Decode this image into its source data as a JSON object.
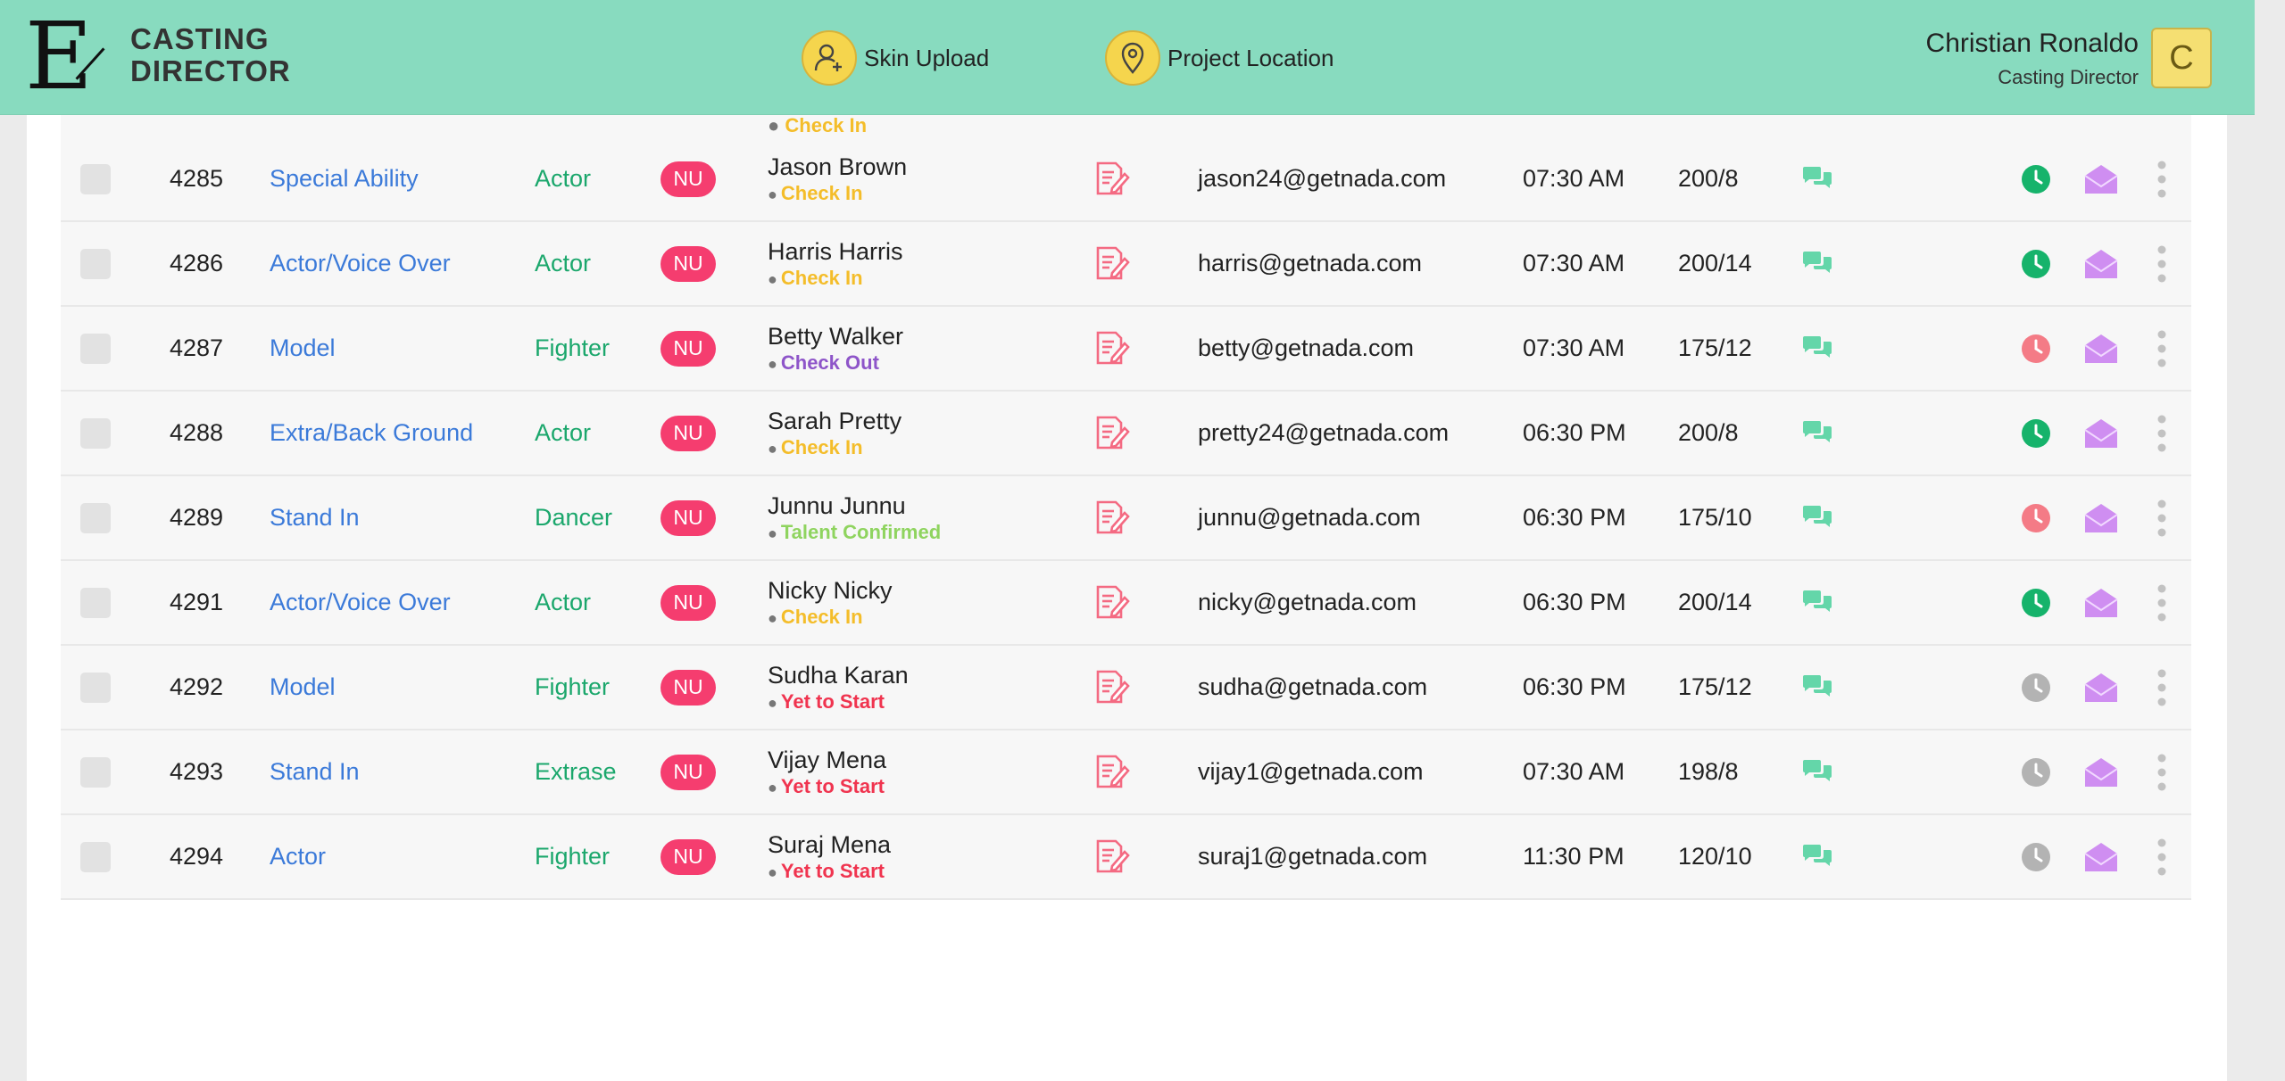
{
  "header": {
    "logo_letter": "E",
    "logo_line1": "CASTING",
    "logo_line2": "DIRECTOR",
    "nav": [
      {
        "label": "Skin Upload",
        "icon": "user-plus-icon"
      },
      {
        "label": "Project Location",
        "icon": "location-pin-icon"
      }
    ],
    "user_name": "Christian Ronaldo",
    "user_role": "Casting Director",
    "avatar_letter": "C"
  },
  "partial_row_status": "Check In",
  "colors": {
    "header_bg": "#88dbbf",
    "badge": "#f53d6f",
    "check_in": "#f4bd2a",
    "check_out": "#8e55c9",
    "talent_confirmed": "#8fd45f",
    "yet_to_start": "#f0344f",
    "clock_green": "#16b36b",
    "clock_red": "#f47b86",
    "clock_gray": "#b3b3b3",
    "chat": "#64d6a9",
    "mail": "#cf8ef1"
  },
  "rows": [
    {
      "id": "4285",
      "role": "Special Ability",
      "type": "Actor",
      "badge": "NU",
      "name": "Jason Brown",
      "status": "Check In",
      "status_kind": "check_in",
      "email": "jason24@getnada.com",
      "time": "07:30 AM",
      "size": "200/8",
      "clock": "green"
    },
    {
      "id": "4286",
      "role": "Actor/Voice Over",
      "type": "Actor",
      "badge": "NU",
      "name": "Harris Harris",
      "status": "Check In",
      "status_kind": "check_in",
      "email": "harris@getnada.com",
      "time": "07:30 AM",
      "size": "200/14",
      "clock": "green"
    },
    {
      "id": "4287",
      "role": "Model",
      "type": "Fighter",
      "badge": "NU",
      "name": "Betty Walker",
      "status": "Check Out",
      "status_kind": "check_out",
      "email": "betty@getnada.com",
      "time": "07:30 AM",
      "size": "175/12",
      "clock": "red"
    },
    {
      "id": "4288",
      "role": "Extra/Back Ground",
      "type": "Actor",
      "badge": "NU",
      "name": "Sarah Pretty",
      "status": "Check In",
      "status_kind": "check_in",
      "email": "pretty24@getnada.com",
      "time": "06:30 PM",
      "size": "200/8",
      "clock": "green"
    },
    {
      "id": "4289",
      "role": "Stand In",
      "type": "Dancer",
      "badge": "NU",
      "name": "Junnu Junnu",
      "status": "Talent Confirmed",
      "status_kind": "talent_confirmed",
      "email": "junnu@getnada.com",
      "time": "06:30 PM",
      "size": "175/10",
      "clock": "red"
    },
    {
      "id": "4291",
      "role": "Actor/Voice Over",
      "type": "Actor",
      "badge": "NU",
      "name": "Nicky Nicky",
      "status": "Check In",
      "status_kind": "check_in",
      "email": "nicky@getnada.com",
      "time": "06:30 PM",
      "size": "200/14",
      "clock": "green"
    },
    {
      "id": "4292",
      "role": "Model",
      "type": "Fighter",
      "badge": "NU",
      "name": "Sudha Karan",
      "status": "Yet to Start",
      "status_kind": "yet_to_start",
      "email": "sudha@getnada.com",
      "time": "06:30 PM",
      "size": "175/12",
      "clock": "gray"
    },
    {
      "id": "4293",
      "role": "Stand In",
      "type": "Extrase",
      "badge": "NU",
      "name": "Vijay Mena",
      "status": "Yet to Start",
      "status_kind": "yet_to_start",
      "email": "vijay1@getnada.com",
      "time": "07:30 AM",
      "size": "198/8",
      "clock": "gray"
    },
    {
      "id": "4294",
      "role": "Actor",
      "type": "Fighter",
      "badge": "NU",
      "name": "Suraj Mena",
      "status": "Yet to Start",
      "status_kind": "yet_to_start",
      "email": "suraj1@getnada.com",
      "time": "11:30 PM",
      "size": "120/10",
      "clock": "gray"
    }
  ]
}
